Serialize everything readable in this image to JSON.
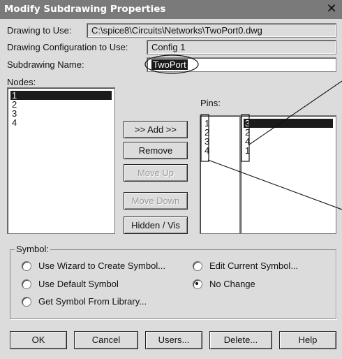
{
  "window": {
    "title": "Modify Subdrawing Properties",
    "close_glyph": "✕"
  },
  "fields": {
    "drawing_to_use_label": "Drawing to Use:",
    "drawing_to_use_value": "C:\\spice8\\Circuits\\Networks\\TwoPort0.dwg",
    "config_label": "Drawing Configuration to Use:",
    "config_value": "Config 1",
    "subdrawing_name_label": "Subdrawing Name:",
    "subdrawing_name_value": "TwoPort"
  },
  "nodes": {
    "label": "Nodes:",
    "items": [
      "1",
      "2",
      "3",
      "4"
    ],
    "selected_index": 0
  },
  "pins": {
    "label": "Pins:",
    "left_items": [
      "1",
      "2",
      "3",
      "4"
    ],
    "right_items": [
      "3",
      "2",
      "4",
      "1"
    ],
    "selected_index": 0
  },
  "middle_buttons": {
    "add": ">> Add >>",
    "remove": "Remove",
    "move_up": "Move Up",
    "move_down": "Move Down",
    "hidden_vis": "Hidden / Vis"
  },
  "symbol": {
    "group_label": "Symbol:",
    "options": [
      {
        "label": "Use Wizard to Create Symbol...",
        "checked": false
      },
      {
        "label": "Use Default Symbol",
        "checked": false
      },
      {
        "label": "Get Symbol From Library...",
        "checked": false
      },
      {
        "label": "Edit Current Symbol...",
        "checked": false
      },
      {
        "label": "No Change",
        "checked": true
      }
    ]
  },
  "bottom_buttons": {
    "ok": "OK",
    "cancel": "Cancel",
    "users": "Users...",
    "delete": "Delete...",
    "help": "Help"
  },
  "colors": {
    "title_bar": "#7a7a7a",
    "dialog_bg": "#dcdcdc",
    "selection": "#1b1b1b"
  }
}
